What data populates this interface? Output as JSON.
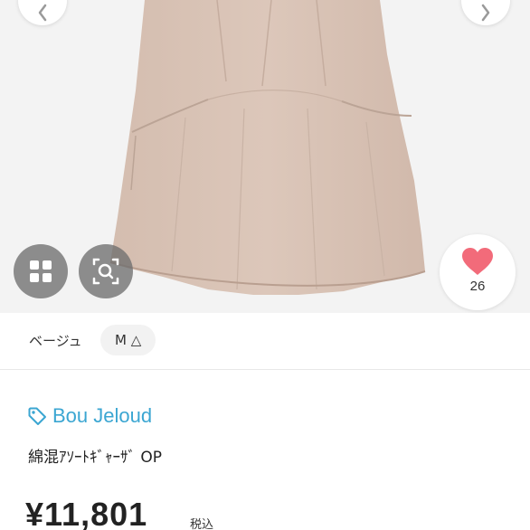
{
  "product": {
    "like_count": "26",
    "variant": {
      "color": "ベージュ",
      "size": "M △"
    },
    "brand": "Bou Jeloud",
    "name": "綿混ｱｿｰﾄｷﾞｬｰｻﾞ OP",
    "price": "¥11,801",
    "tax_label": "税込"
  },
  "colors": {
    "brand_accent": "#3ba6d2",
    "like_heart": "#f26b7a",
    "garment": "#d8c2b4",
    "overlay_button": "#6e6e6e"
  },
  "icons": {
    "prev": "chevron-left-icon",
    "next": "chevron-right-icon",
    "grid": "grid-icon",
    "zoom": "image-search-icon",
    "like": "heart-icon",
    "brand": "tag-icon"
  }
}
